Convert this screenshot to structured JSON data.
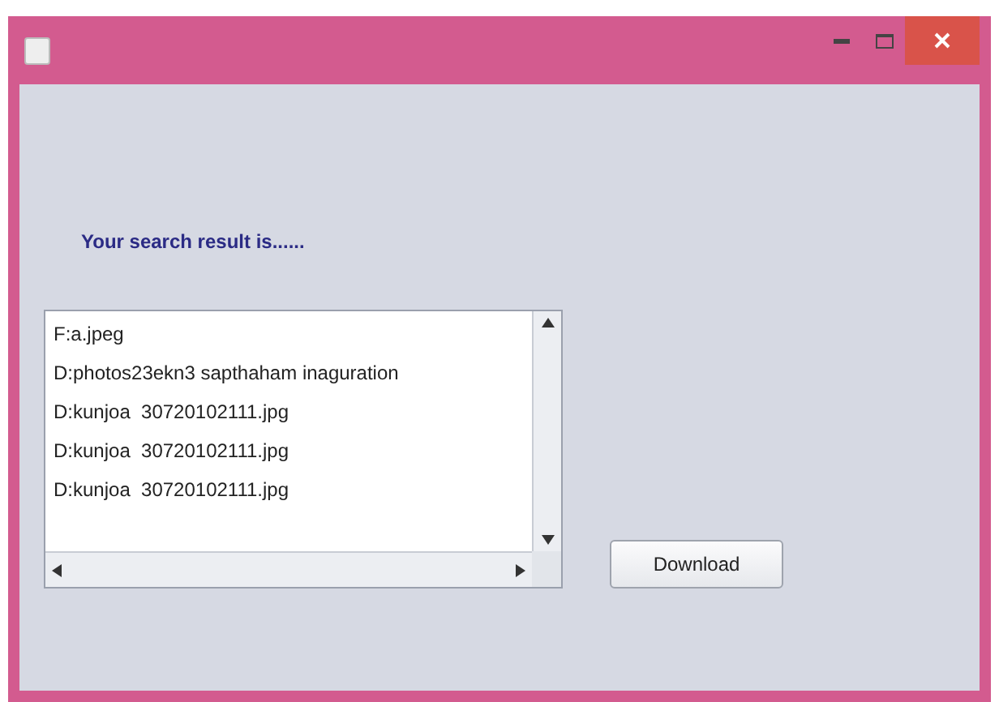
{
  "heading": "Your search result is......",
  "results": [
    "F:a.jpeg",
    "D:photos23ekn3 sapthaham inaguration",
    "D:kunjoa  30720102111.jpg",
    "D:kunjoa  30720102111.jpg",
    "D:kunjoa  30720102111.jpg"
  ],
  "buttons": [
    "Download"
  ]
}
